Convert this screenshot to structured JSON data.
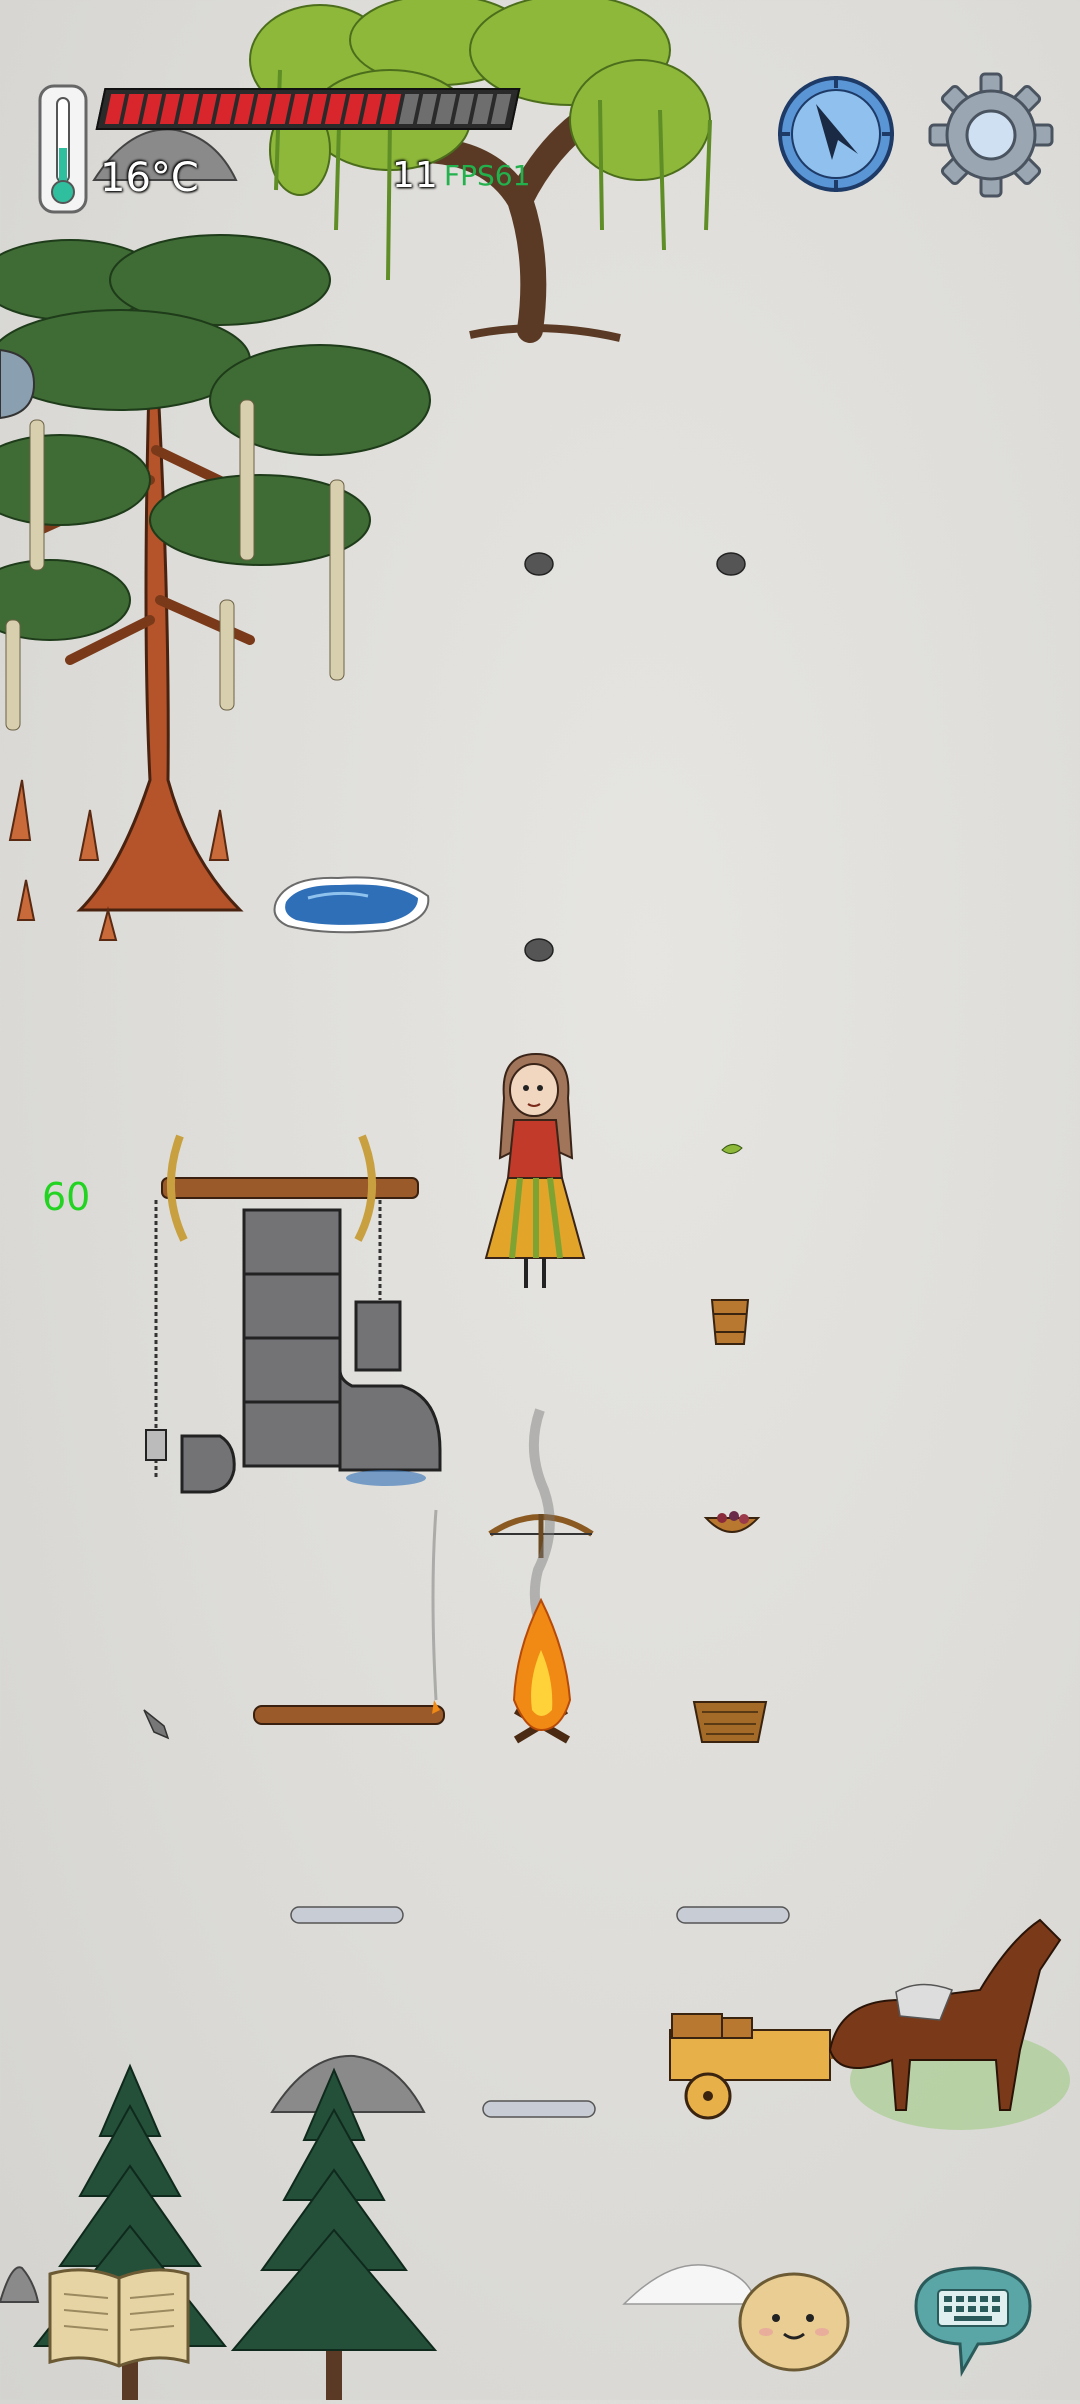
{
  "hud": {
    "temperature": "16°C",
    "food_pips_total": 22,
    "food_pips_filled": 16,
    "counter": "11",
    "fps": "FPS61",
    "side_number": "60",
    "colors": {
      "health": "#d8262c",
      "fps": "#22b14c",
      "side_number": "#22d322"
    }
  },
  "controls": {
    "compass_icon": "compass-icon",
    "settings_icon": "gear-icon",
    "journal_icon": "open-book-icon",
    "emote_icon": "face-icon",
    "chat_icon": "keyboard-bubble-icon"
  },
  "world": {
    "objects": [
      "willow-tree",
      "cypress-tree",
      "pine-tree",
      "stone",
      "ice-pond",
      "well-pump",
      "girl-character",
      "wooden-bucket",
      "basket",
      "berry-bowl",
      "bow-drill",
      "campfire",
      "fire-log",
      "steel-pipe",
      "horse-cart",
      "snow-pile"
    ]
  }
}
